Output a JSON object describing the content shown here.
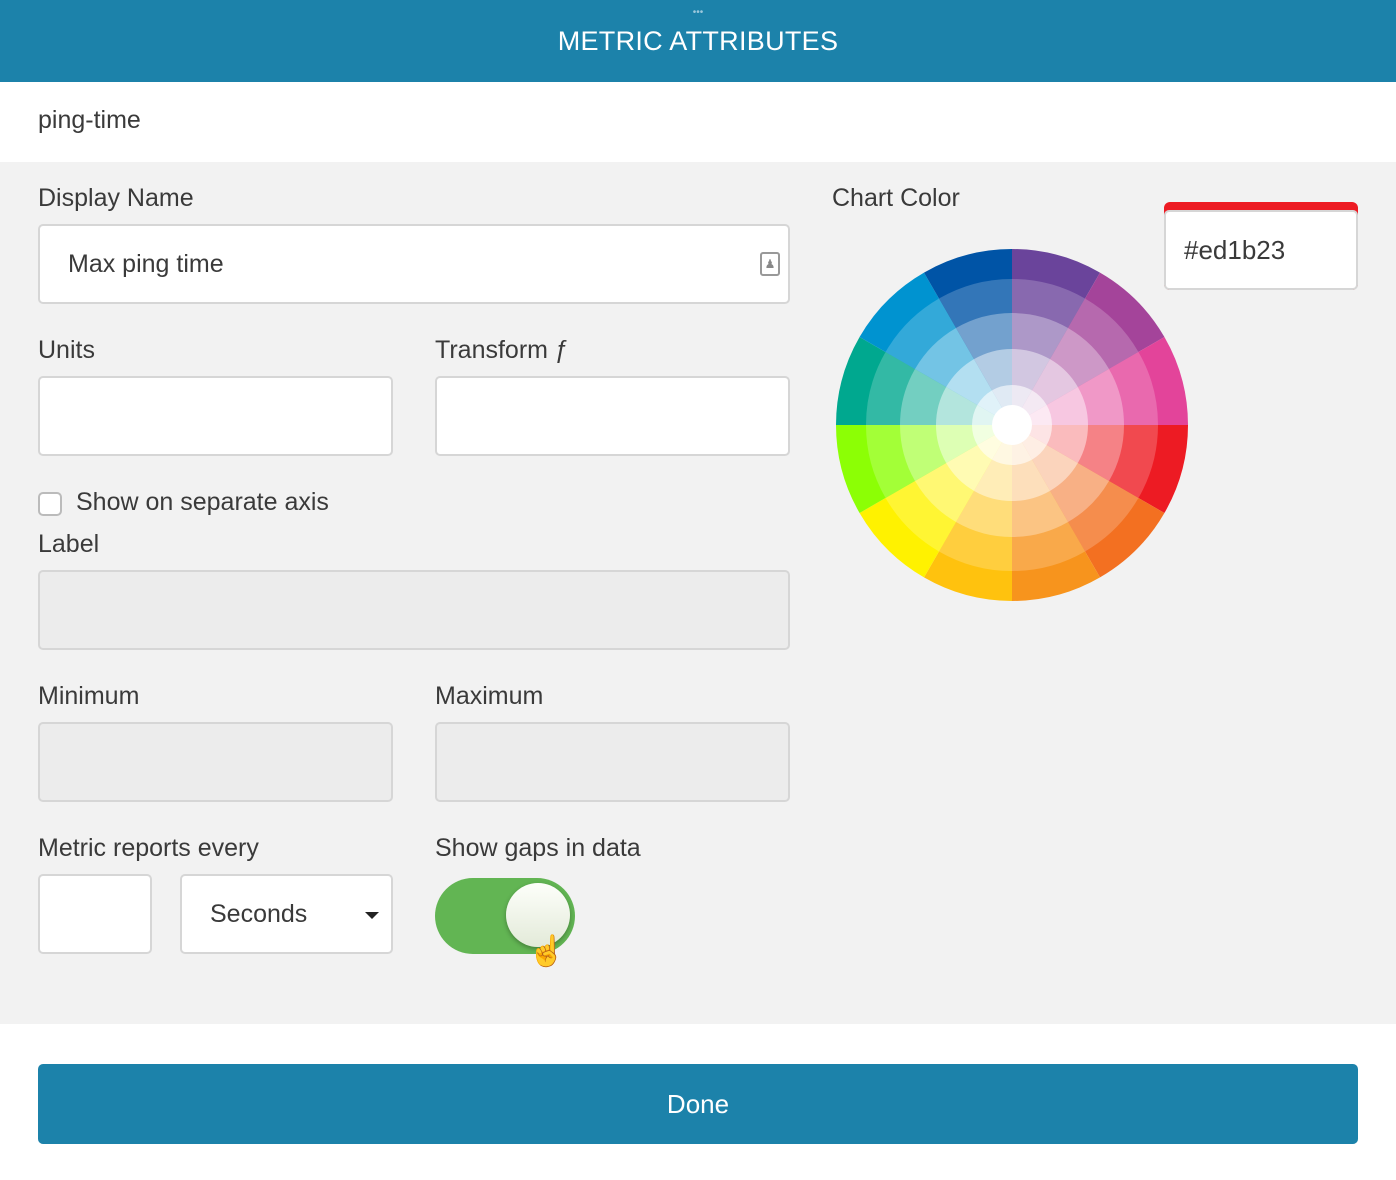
{
  "header": {
    "title": "METRIC ATTRIBUTES",
    "grip": "•••"
  },
  "metric_id": "ping-time",
  "form": {
    "display_name_label": "Display Name",
    "display_name_value": "Max ping time",
    "units_label": "Units",
    "units_value": "",
    "transform_label": "Transform ƒ",
    "transform_value": "",
    "separate_axis_label": "Show on separate axis",
    "separate_axis_checked": false,
    "label_label": "Label",
    "label_value": "",
    "minimum_label": "Minimum",
    "minimum_value": "",
    "maximum_label": "Maximum",
    "maximum_value": "",
    "reports_every_label": "Metric reports every",
    "reports_every_value": "",
    "reports_every_unit": "Seconds",
    "show_gaps_label": "Show gaps in data",
    "show_gaps_on": true
  },
  "chart_color": {
    "label": "Chart Color",
    "hex": "#ed1b23",
    "wheel_colors": [
      "#6a449b",
      "#a4449a",
      "#e3449a",
      "#ed1b23",
      "#f37021",
      "#f7941d",
      "#ffc20e",
      "#fff200",
      "#8cff05",
      "#00a88f",
      "#0093d0",
      "#0054a6"
    ]
  },
  "done_label": "Done",
  "colors": {
    "accent": "#1c82aa",
    "toggle_on": "#62b553"
  }
}
